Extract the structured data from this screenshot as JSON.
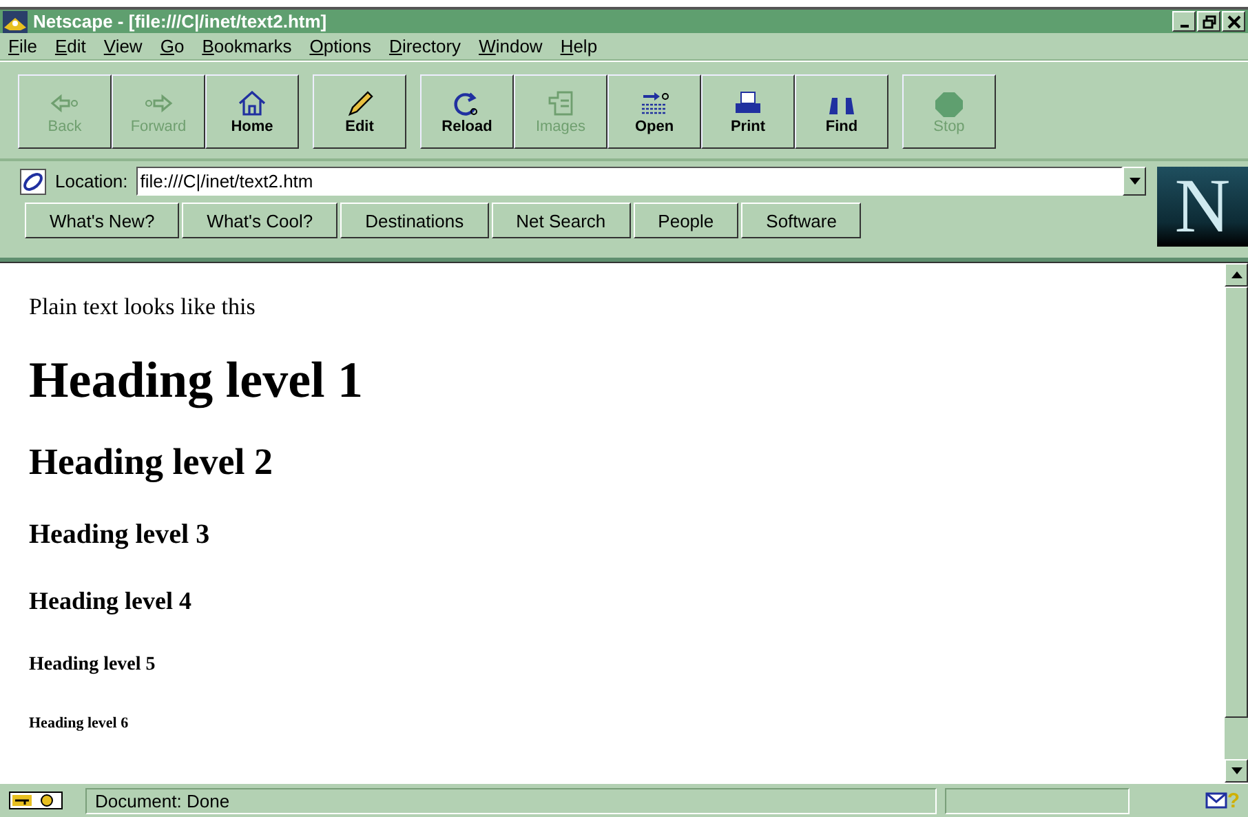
{
  "window": {
    "title": "Netscape - [file:///C|/inet/text2.htm]"
  },
  "menu": [
    "File",
    "Edit",
    "View",
    "Go",
    "Bookmarks",
    "Options",
    "Directory",
    "Window",
    "Help"
  ],
  "toolbar": [
    [
      {
        "label": "Back",
        "kind": "back",
        "disabled": true
      },
      {
        "label": "Forward",
        "kind": "forward",
        "disabled": true
      },
      {
        "label": "Home",
        "kind": "home",
        "disabled": false
      }
    ],
    [
      {
        "label": "Edit",
        "kind": "edit",
        "disabled": false
      }
    ],
    [
      {
        "label": "Reload",
        "kind": "reload",
        "disabled": false
      },
      {
        "label": "Images",
        "kind": "images",
        "disabled": true
      },
      {
        "label": "Open",
        "kind": "open",
        "disabled": false
      },
      {
        "label": "Print",
        "kind": "print",
        "disabled": false
      },
      {
        "label": "Find",
        "kind": "find",
        "disabled": false
      }
    ],
    [
      {
        "label": "Stop",
        "kind": "stop",
        "disabled": true
      }
    ]
  ],
  "location": {
    "label": "Location:",
    "value": "file:///C|/inet/text2.htm"
  },
  "logo": "N",
  "directory_buttons": [
    "What's New?",
    "What's Cool?",
    "Destinations",
    "Net Search",
    "People",
    "Software"
  ],
  "content": [
    {
      "kind": "p",
      "text": "Plain text looks like this"
    },
    {
      "kind": "h1",
      "text": "Heading level 1"
    },
    {
      "kind": "h2",
      "text": "Heading level 2"
    },
    {
      "kind": "h3",
      "text": "Heading level 3"
    },
    {
      "kind": "h4",
      "text": "Heading level 4"
    },
    {
      "kind": "h5",
      "text": "Heading level 5"
    },
    {
      "kind": "h6",
      "text": "Heading level 6"
    }
  ],
  "status_bar": {
    "text": "Document: Done",
    "help": "?"
  }
}
